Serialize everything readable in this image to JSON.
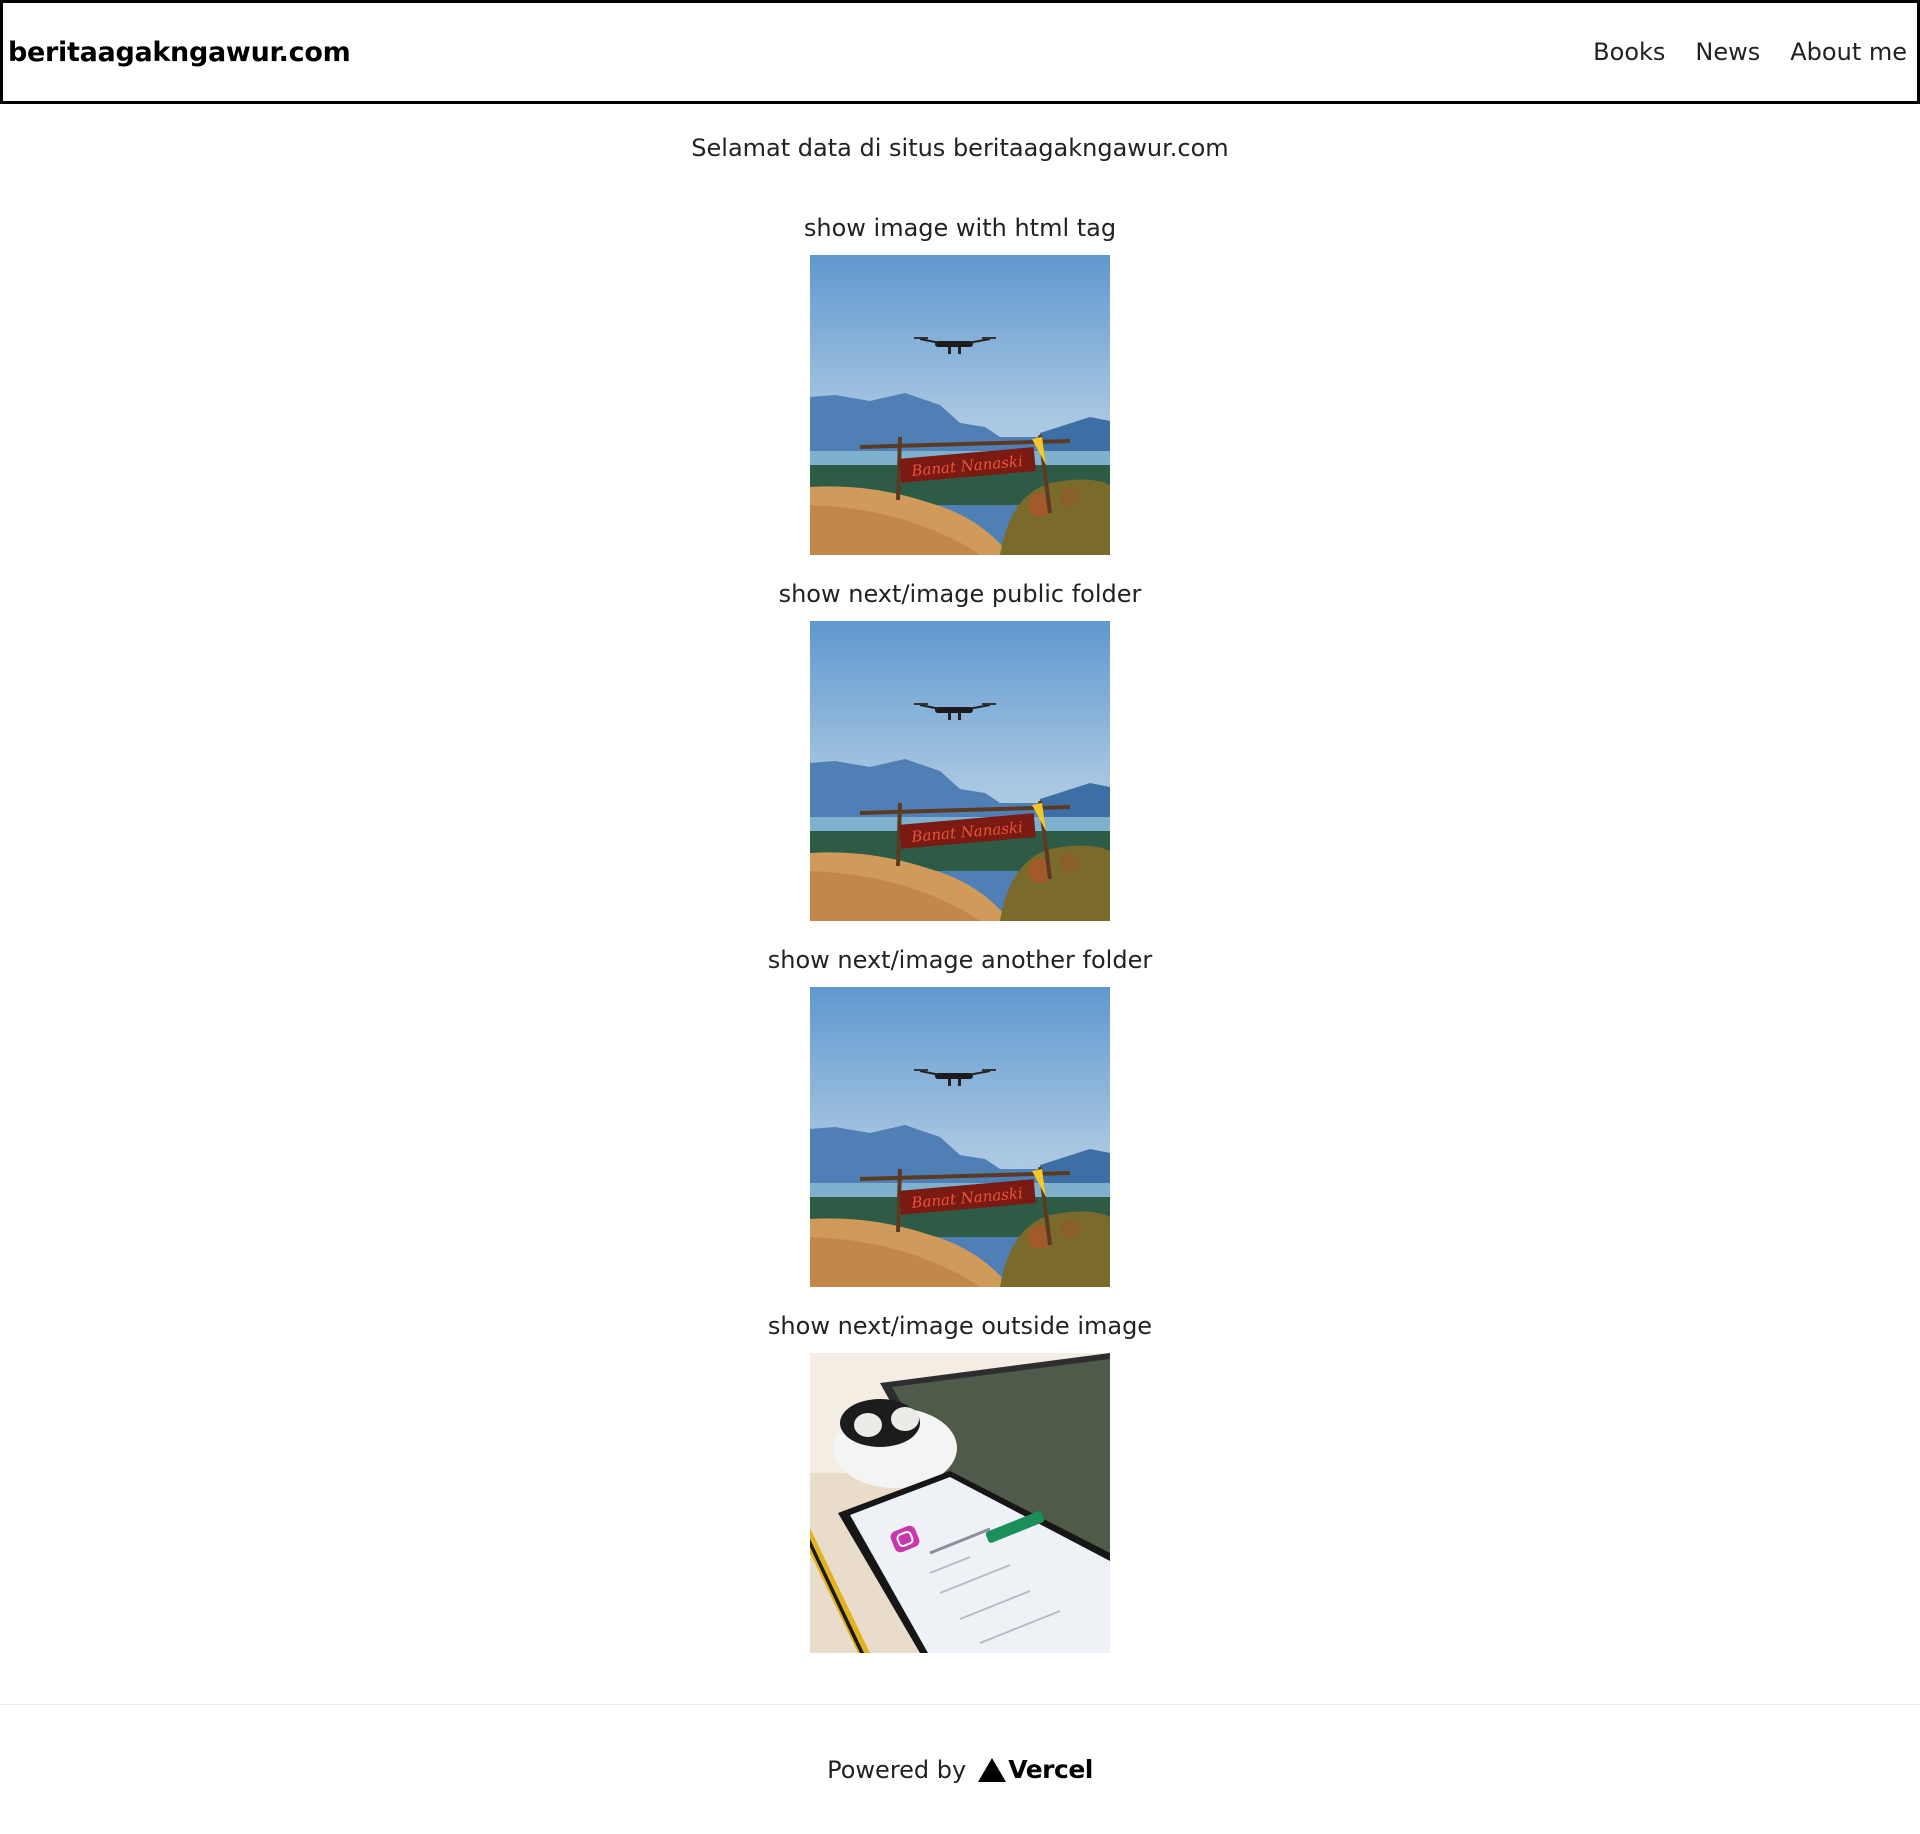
{
  "header": {
    "brand": "beritaagakngawur.com",
    "nav": [
      {
        "label": "Books"
      },
      {
        "label": "News"
      },
      {
        "label": "About me"
      }
    ]
  },
  "main": {
    "welcome": "Selamat data di situs beritaagakngawur.com",
    "sections": [
      {
        "caption": "show image with html tag",
        "image": "drone-over-mountain-sign-photo",
        "sign_text": "Banat Nanaski"
      },
      {
        "caption": "show next/image public folder",
        "image": "drone-over-mountain-sign-photo",
        "sign_text": "Banat Nanaski"
      },
      {
        "caption": "show next/image another folder",
        "image": "drone-over-mountain-sign-photo",
        "sign_text": "Banat Nanaski"
      },
      {
        "caption": "show next/image outside image",
        "image": "phone-instagram-earbuds-photo"
      }
    ]
  },
  "footer": {
    "powered_by": "Powered by",
    "brand": "Vercel"
  },
  "colors": {
    "border": "#000000",
    "text": "#222222",
    "background": "#ffffff"
  }
}
